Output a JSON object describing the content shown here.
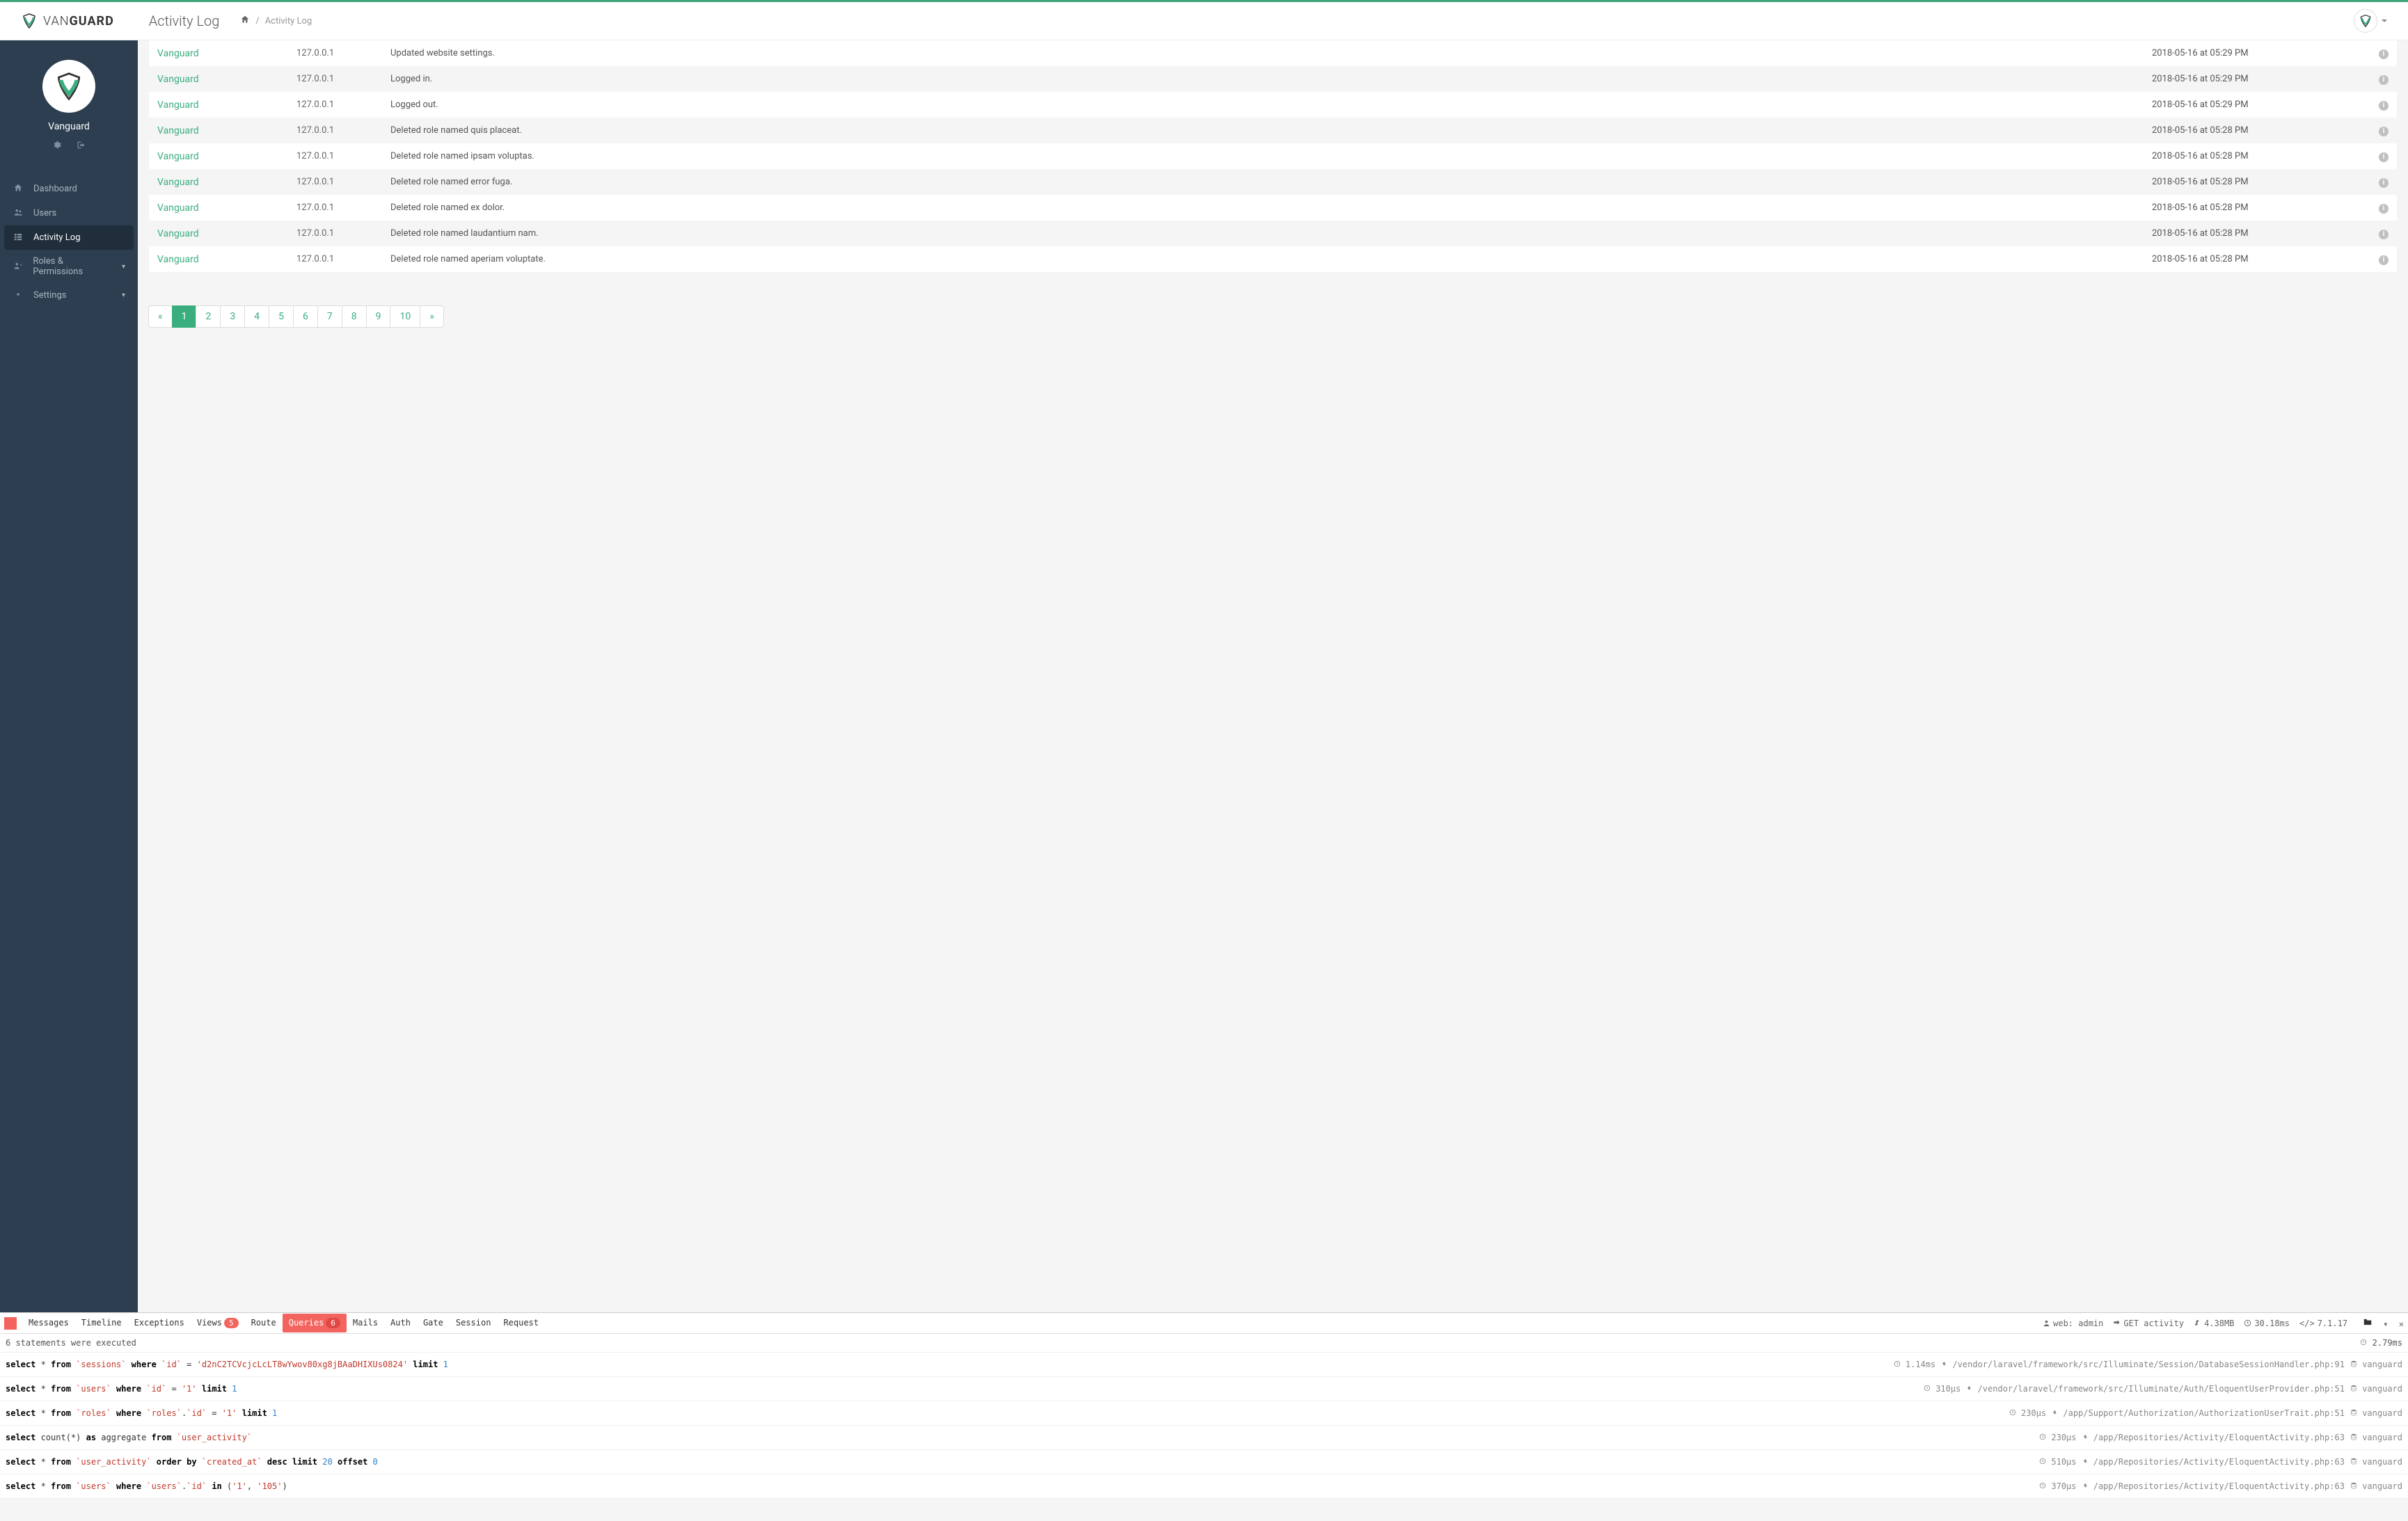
{
  "brand": {
    "first": "VAN",
    "second": "GUARD"
  },
  "header": {
    "title": "Activity Log"
  },
  "breadcrumb": {
    "current": "Activity Log"
  },
  "sidebar": {
    "username": "Vanguard",
    "nav": [
      {
        "label": "Dashboard",
        "active": false,
        "caret": false
      },
      {
        "label": "Users",
        "active": false,
        "caret": false
      },
      {
        "label": "Activity Log",
        "active": true,
        "caret": false
      },
      {
        "label": "Roles & Permissions",
        "active": false,
        "caret": true
      },
      {
        "label": "Settings",
        "active": false,
        "caret": true
      }
    ]
  },
  "rows": [
    {
      "user": "Vanguard",
      "ip": "127.0.0.1",
      "msg": "Updated website settings.",
      "time": "2018-05-16 at 05:29 PM"
    },
    {
      "user": "Vanguard",
      "ip": "127.0.0.1",
      "msg": "Logged in.",
      "time": "2018-05-16 at 05:29 PM"
    },
    {
      "user": "Vanguard",
      "ip": "127.0.0.1",
      "msg": "Logged out.",
      "time": "2018-05-16 at 05:29 PM"
    },
    {
      "user": "Vanguard",
      "ip": "127.0.0.1",
      "msg": "Deleted role named quis placeat.",
      "time": "2018-05-16 at 05:28 PM"
    },
    {
      "user": "Vanguard",
      "ip": "127.0.0.1",
      "msg": "Deleted role named ipsam voluptas.",
      "time": "2018-05-16 at 05:28 PM"
    },
    {
      "user": "Vanguard",
      "ip": "127.0.0.1",
      "msg": "Deleted role named error fuga.",
      "time": "2018-05-16 at 05:28 PM"
    },
    {
      "user": "Vanguard",
      "ip": "127.0.0.1",
      "msg": "Deleted role named ex dolor.",
      "time": "2018-05-16 at 05:28 PM"
    },
    {
      "user": "Vanguard",
      "ip": "127.0.0.1",
      "msg": "Deleted role named laudantium nam.",
      "time": "2018-05-16 at 05:28 PM"
    },
    {
      "user": "Vanguard",
      "ip": "127.0.0.1",
      "msg": "Deleted role named aperiam voluptate.",
      "time": "2018-05-16 at 05:28 PM"
    }
  ],
  "pagination": {
    "prev": "«",
    "next": "»",
    "pages": [
      "1",
      "2",
      "3",
      "4",
      "5",
      "6",
      "7",
      "8",
      "9",
      "10"
    ],
    "active": "1"
  },
  "debugbar": {
    "tabs": [
      {
        "label": "Messages"
      },
      {
        "label": "Timeline"
      },
      {
        "label": "Exceptions"
      },
      {
        "label": "Views",
        "badge": "5"
      },
      {
        "label": "Route"
      },
      {
        "label": "Queries",
        "badge": "6",
        "active": true
      },
      {
        "label": "Mails"
      },
      {
        "label": "Auth"
      },
      {
        "label": "Gate"
      },
      {
        "label": "Session"
      },
      {
        "label": "Request"
      }
    ],
    "right": {
      "user": "web: admin",
      "route": "GET activity",
      "mem": "4.38MB",
      "time": "30.18ms",
      "version": "7.1.17"
    },
    "summary": {
      "text": "6 statements were executed",
      "total": "2.79ms"
    },
    "queries": [
      {
        "sql_parts": [
          {
            "t": "kw",
            "v": "select"
          },
          {
            "t": "p",
            "v": " * "
          },
          {
            "t": "kw",
            "v": "from"
          },
          {
            "t": "p",
            "v": " "
          },
          {
            "t": "id",
            "v": "`sessions`"
          },
          {
            "t": "p",
            "v": " "
          },
          {
            "t": "kw",
            "v": "where"
          },
          {
            "t": "p",
            "v": " "
          },
          {
            "t": "id",
            "v": "`id`"
          },
          {
            "t": "p",
            "v": " = "
          },
          {
            "t": "str",
            "v": "'d2nC2TCVcjcLcLT8wYwov80xg8jBAaDHIXUs0824'"
          },
          {
            "t": "p",
            "v": " "
          },
          {
            "t": "kw",
            "v": "limit"
          },
          {
            "t": "p",
            "v": " "
          },
          {
            "t": "num",
            "v": "1"
          }
        ],
        "time": "1.14ms",
        "path": "/vendor/laravel/framework/src/Illuminate/Session/DatabaseSessionHandler.php:91",
        "conn": "vanguard"
      },
      {
        "sql_parts": [
          {
            "t": "kw",
            "v": "select"
          },
          {
            "t": "p",
            "v": " * "
          },
          {
            "t": "kw",
            "v": "from"
          },
          {
            "t": "p",
            "v": " "
          },
          {
            "t": "id",
            "v": "`users`"
          },
          {
            "t": "p",
            "v": " "
          },
          {
            "t": "kw",
            "v": "where"
          },
          {
            "t": "p",
            "v": " "
          },
          {
            "t": "id",
            "v": "`id`"
          },
          {
            "t": "p",
            "v": " = "
          },
          {
            "t": "str",
            "v": "'1'"
          },
          {
            "t": "p",
            "v": " "
          },
          {
            "t": "kw",
            "v": "limit"
          },
          {
            "t": "p",
            "v": " "
          },
          {
            "t": "num",
            "v": "1"
          }
        ],
        "time": "310µs",
        "path": "/vendor/laravel/framework/src/Illuminate/Auth/EloquentUserProvider.php:51",
        "conn": "vanguard"
      },
      {
        "sql_parts": [
          {
            "t": "kw",
            "v": "select"
          },
          {
            "t": "p",
            "v": " * "
          },
          {
            "t": "kw",
            "v": "from"
          },
          {
            "t": "p",
            "v": " "
          },
          {
            "t": "id",
            "v": "`roles`"
          },
          {
            "t": "p",
            "v": " "
          },
          {
            "t": "kw",
            "v": "where"
          },
          {
            "t": "p",
            "v": " "
          },
          {
            "t": "id",
            "v": "`roles`"
          },
          {
            "t": "p",
            "v": "."
          },
          {
            "t": "id",
            "v": "`id`"
          },
          {
            "t": "p",
            "v": " = "
          },
          {
            "t": "str",
            "v": "'1'"
          },
          {
            "t": "p",
            "v": " "
          },
          {
            "t": "kw",
            "v": "limit"
          },
          {
            "t": "p",
            "v": " "
          },
          {
            "t": "num",
            "v": "1"
          }
        ],
        "time": "230µs",
        "path": "/app/Support/Authorization/AuthorizationUserTrait.php:51",
        "conn": "vanguard"
      },
      {
        "sql_parts": [
          {
            "t": "kw",
            "v": "select"
          },
          {
            "t": "p",
            "v": " count(*) "
          },
          {
            "t": "kw",
            "v": "as"
          },
          {
            "t": "p",
            "v": " aggregate "
          },
          {
            "t": "kw",
            "v": "from"
          },
          {
            "t": "p",
            "v": " "
          },
          {
            "t": "id",
            "v": "`user_activity`"
          }
        ],
        "time": "230µs",
        "path": "/app/Repositories/Activity/EloquentActivity.php:63",
        "conn": "vanguard"
      },
      {
        "sql_parts": [
          {
            "t": "kw",
            "v": "select"
          },
          {
            "t": "p",
            "v": " * "
          },
          {
            "t": "kw",
            "v": "from"
          },
          {
            "t": "p",
            "v": " "
          },
          {
            "t": "id",
            "v": "`user_activity`"
          },
          {
            "t": "p",
            "v": " "
          },
          {
            "t": "kw",
            "v": "order by"
          },
          {
            "t": "p",
            "v": " "
          },
          {
            "t": "id",
            "v": "`created_at`"
          },
          {
            "t": "p",
            "v": " "
          },
          {
            "t": "kw",
            "v": "desc"
          },
          {
            "t": "p",
            "v": " "
          },
          {
            "t": "kw",
            "v": "limit"
          },
          {
            "t": "p",
            "v": " "
          },
          {
            "t": "num",
            "v": "20"
          },
          {
            "t": "p",
            "v": " "
          },
          {
            "t": "kw",
            "v": "offset"
          },
          {
            "t": "p",
            "v": " "
          },
          {
            "t": "num",
            "v": "0"
          }
        ],
        "time": "510µs",
        "path": "/app/Repositories/Activity/EloquentActivity.php:63",
        "conn": "vanguard"
      },
      {
        "sql_parts": [
          {
            "t": "kw",
            "v": "select"
          },
          {
            "t": "p",
            "v": " * "
          },
          {
            "t": "kw",
            "v": "from"
          },
          {
            "t": "p",
            "v": " "
          },
          {
            "t": "id",
            "v": "`users`"
          },
          {
            "t": "p",
            "v": " "
          },
          {
            "t": "kw",
            "v": "where"
          },
          {
            "t": "p",
            "v": " "
          },
          {
            "t": "id",
            "v": "`users`"
          },
          {
            "t": "p",
            "v": "."
          },
          {
            "t": "id",
            "v": "`id`"
          },
          {
            "t": "p",
            "v": " "
          },
          {
            "t": "kw",
            "v": "in"
          },
          {
            "t": "p",
            "v": " ("
          },
          {
            "t": "str",
            "v": "'1'"
          },
          {
            "t": "p",
            "v": ", "
          },
          {
            "t": "str",
            "v": "'105'"
          },
          {
            "t": "p",
            "v": ")"
          }
        ],
        "time": "370µs",
        "path": "/app/Repositories/Activity/EloquentActivity.php:63",
        "conn": "vanguard"
      }
    ]
  }
}
